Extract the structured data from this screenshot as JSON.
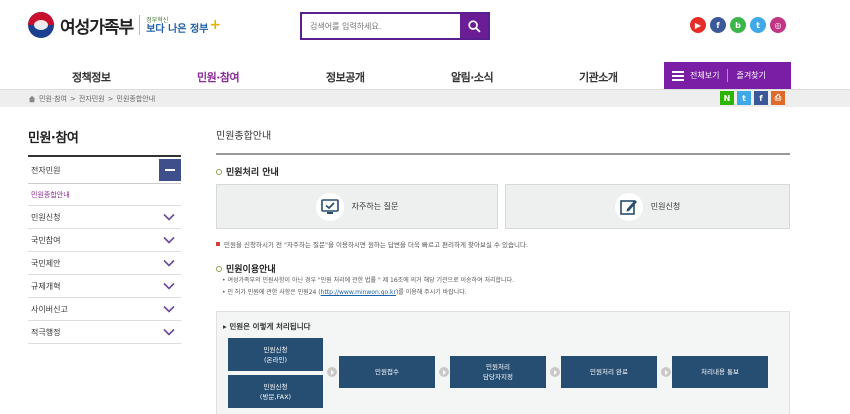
{
  "header": {
    "logo_text": "여성가족부",
    "logo_sub1": "정부혁신",
    "logo_sub2": "보다 나은 정부",
    "search_placeholder": "검색어를 입력하세요."
  },
  "sns": [
    {
      "name": "youtube-icon",
      "glyph": "▶",
      "color": "#e52d27"
    },
    {
      "name": "facebook-icon",
      "glyph": "f",
      "color": "#3b5998"
    },
    {
      "name": "blog-icon",
      "glyph": "b",
      "color": "#3cb54a"
    },
    {
      "name": "twitter-icon",
      "glyph": "t",
      "color": "#3fa9e8"
    },
    {
      "name": "instagram-icon",
      "glyph": "◎",
      "color": "#c13584"
    }
  ],
  "gnb": {
    "items": [
      "정책정보",
      "민원·참여",
      "정보공개",
      "알림·소식",
      "기관소개"
    ],
    "view_all": "전체보기",
    "favorites": "즐겨찾기"
  },
  "breadcrumb": [
    "민원·참여",
    "전자민원",
    "민원종합안내"
  ],
  "share": [
    {
      "name": "naver-share-icon",
      "glyph": "N",
      "color": "#2db400"
    },
    {
      "name": "twitter-share-icon",
      "glyph": "t",
      "color": "#3fa9e8"
    },
    {
      "name": "facebook-share-icon",
      "glyph": "f",
      "color": "#3b5998"
    },
    {
      "name": "print-icon",
      "glyph": "⎙",
      "color": "#e06a2a"
    }
  ],
  "sidebar": {
    "title": "민원·참여",
    "head": "전자민원",
    "sub": "민원종합안내",
    "items": [
      "민원신청",
      "국민참여",
      "국민제안",
      "규제개혁",
      "사이버신고",
      "적극행정"
    ]
  },
  "content": {
    "title": "민원종합안내",
    "section1": "민원처리 안내",
    "faq_label": "자주하는 질문",
    "apply_label": "민원신청",
    "note": "민원을 신청하시기 전 \"자주하는 질문\"을 이용하시면 원하는 답변을 더욱 빠르고 편리하게 찾아보실 수 있습니다.",
    "section2": "민원이용안내",
    "info1": "• 여성가족부의 민원사항이 아닌 경우 \"민원 처리에 관한 법률 \" 제 16조에 의거 해당 기관으로 이송하여 처리합니다.",
    "info2_pre": "• 인 허가 민원에 관한 사항은 민원24 (",
    "info2_link": "http://www.minwon.go.kr",
    "info2_post": ")를 이용해 주시기 바랍니다.",
    "process_title": "▸ 민원은 이렇게 처리됩니다",
    "steps": {
      "online1": "민원신청",
      "online2": "(온라인)",
      "offline1": "민원신청",
      "offline2": "(방문,FAX)",
      "receive": "민원접수",
      "assign1": "민원처리",
      "assign2": "담당자지정",
      "done": "민원처리 완료",
      "notify": "처리내용 통보"
    }
  },
  "colors": {
    "accent": "#7a1ea5",
    "navy": "#264d72",
    "sidebar_btn": "#3f4f8c"
  }
}
